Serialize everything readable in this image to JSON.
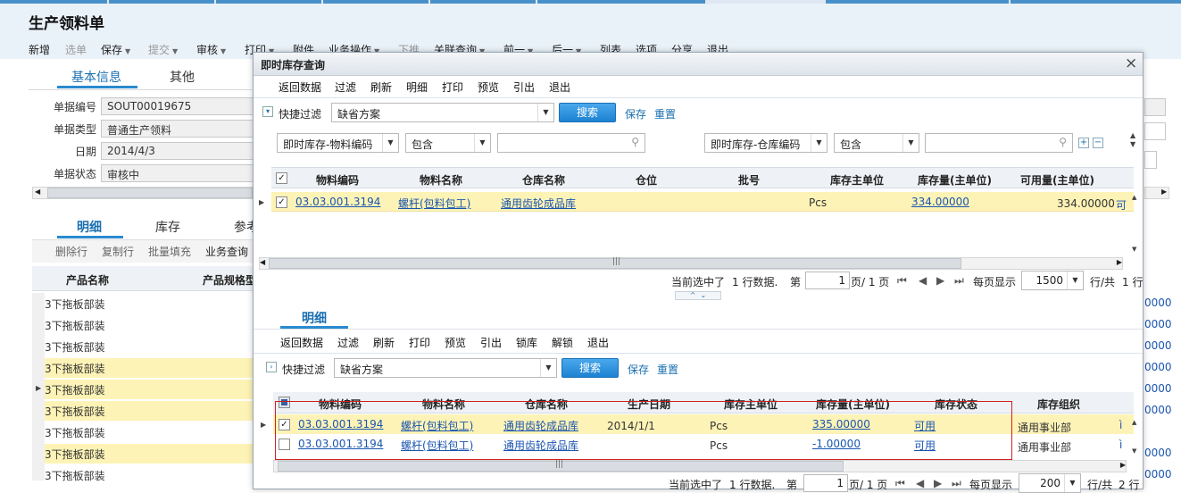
{
  "page": {
    "title": "生产领料单",
    "toolbar": [
      {
        "label": "新增",
        "dropdown": false,
        "disabled": false
      },
      {
        "label": "选单",
        "dropdown": false,
        "disabled": true
      },
      {
        "label": "保存",
        "dropdown": true,
        "disabled": false
      },
      {
        "label": "提交",
        "dropdown": true,
        "disabled": true
      },
      {
        "label": "审核",
        "dropdown": true,
        "disabled": false
      },
      {
        "label": "打印",
        "dropdown": true,
        "disabled": false
      },
      {
        "label": "附件",
        "dropdown": false,
        "disabled": false
      },
      {
        "label": "业务操作",
        "dropdown": true,
        "disabled": false
      },
      {
        "label": "下推",
        "dropdown": false,
        "disabled": true
      },
      {
        "label": "关联查询",
        "dropdown": true,
        "disabled": false
      },
      {
        "label": "前一",
        "dropdown": true,
        "disabled": false
      },
      {
        "label": "后一",
        "dropdown": true,
        "disabled": false
      },
      {
        "label": "列表",
        "dropdown": false,
        "disabled": false
      },
      {
        "label": "选项",
        "dropdown": false,
        "disabled": false
      },
      {
        "label": "分享",
        "dropdown": false,
        "disabled": false
      },
      {
        "label": "退出",
        "dropdown": false,
        "disabled": false
      }
    ],
    "tabs": {
      "active": "基本信息",
      "other": "其他"
    },
    "fields": [
      {
        "label": "单据编号",
        "value": "SOUT00019675"
      },
      {
        "label": "单据类型",
        "value": "普通生产领料"
      },
      {
        "label": "日期",
        "value": "2014/4/3"
      },
      {
        "label": "单据状态",
        "value": "审核中"
      }
    ],
    "detail_tabs": {
      "active": "明细",
      "t2": "库存",
      "t3": "参考"
    },
    "grid_buttons": [
      "删除行",
      "复制行",
      "批量填充",
      "业务查询"
    ],
    "grid_headers": {
      "c1": "产品名称",
      "c2": "产品规格型"
    },
    "rows": [
      "3下拖板部装",
      "3下拖板部装",
      "3下拖板部装",
      "3下拖板部装",
      "3下拖板部装",
      "3下拖板部装",
      "3下拖板部装",
      "3下拖板部装",
      "3下拖板部装"
    ],
    "right_values": [
      "0000",
      "0000",
      "0000",
      "0000",
      "0000",
      "0000",
      "0000",
      "0000"
    ]
  },
  "dialog": {
    "title": "即时库存查询",
    "close": "×",
    "menu": [
      "返回数据",
      "过滤",
      "刷新",
      "明细",
      "打印",
      "预览",
      "引出",
      "退出"
    ],
    "quick_filter_label": "快捷过滤",
    "scheme": "缺省方案",
    "search_label": "搜索",
    "save_label": "保存",
    "reset_label": "重置",
    "filter1_field": "即时库存-物料编码",
    "filter1_op": "包含",
    "filter2_field": "即时库存-仓库编码",
    "filter2_op": "包含",
    "headers": [
      "物料编码",
      "物料名称",
      "仓库名称",
      "仓位",
      "批号",
      "库存主单位",
      "库存量(主单位)",
      "可用量(主单位)"
    ],
    "row": {
      "code": "03.03.001.3194",
      "name": "螺杆(包料包工)",
      "warehouse": "通用齿轮成品库",
      "unit": "Pcs",
      "qty": "334.00000",
      "avail": "334.00000",
      "extra": "可"
    },
    "pager": {
      "text1": "当前选中了",
      "selected": "1 行数据.",
      "page_label": "第",
      "page": "1",
      "total": "页/ 1 页",
      "per_label": "每页显示",
      "per": "1500",
      "rows_label": "行/共",
      "rows_total": "1 行"
    },
    "detail": {
      "tab": "明细",
      "menu": [
        "返回数据",
        "过滤",
        "刷新",
        "打印",
        "预览",
        "引出",
        "锁库",
        "解锁",
        "退出"
      ],
      "quick_filter_label": "快捷过滤",
      "scheme": "缺省方案",
      "search_label": "搜索",
      "save_label": "保存",
      "reset_label": "重置",
      "headers": [
        "物料编码",
        "物料名称",
        "仓库名称",
        "生产日期",
        "库存主单位",
        "库存量(主单位)",
        "库存状态",
        "库存组织"
      ],
      "rows": [
        {
          "code": "03.03.001.3194",
          "name": "螺杆(包料包工)",
          "warehouse": "通用齿轮成品库",
          "date": "2014/1/1",
          "unit": "Pcs",
          "qty": "335.00000",
          "status": "可用",
          "org": "通用事业部",
          "extra": "ì",
          "checked": true
        },
        {
          "code": "03.03.001.3194",
          "name": "螺杆(包料包工)",
          "warehouse": "通用齿轮成品库",
          "date": "",
          "unit": "Pcs",
          "qty": "-1.00000",
          "status": "可用",
          "org": "通用事业部",
          "extra": "ì",
          "checked": false
        }
      ],
      "pager": {
        "text1": "当前选中了",
        "selected": "1 行数据.",
        "page_label": "第",
        "page": "1",
        "total": "页/ 1 页",
        "per_label": "每页显示",
        "per": "200",
        "rows_label": "行/共",
        "rows_total": "2 行"
      }
    }
  }
}
